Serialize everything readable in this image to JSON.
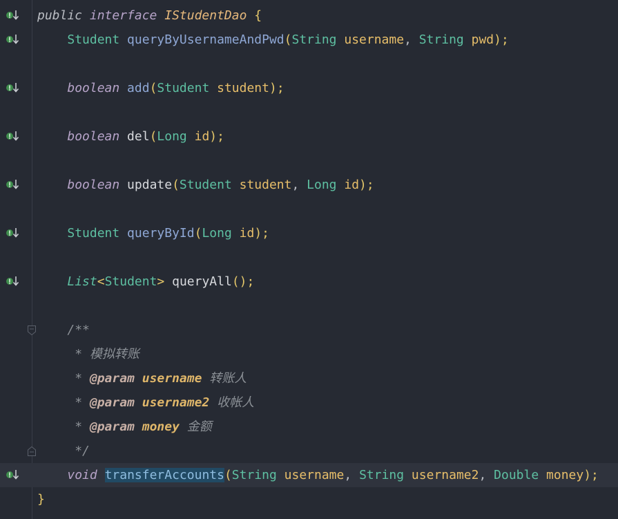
{
  "editor": {
    "lines": [
      {
        "parts": [
          {
            "t": "public ",
            "c": "mod"
          },
          {
            "t": "interface ",
            "c": "kw"
          },
          {
            "t": "IStudentDao",
            "c": "iname"
          },
          {
            "t": " {",
            "c": "br"
          }
        ],
        "gutter": true
      },
      {
        "parts": [
          {
            "t": "    "
          },
          {
            "t": "Student",
            "c": "typ"
          },
          {
            "t": " queryByUsernameAndPwd",
            "c": "decl"
          },
          {
            "t": "(",
            "c": "br"
          },
          {
            "t": "String",
            "c": "typ"
          },
          {
            "t": " username",
            "c": "param"
          },
          {
            "t": ", ",
            "c": "punc"
          },
          {
            "t": "String",
            "c": "typ"
          },
          {
            "t": " pwd",
            "c": "param"
          },
          {
            "t": ");",
            "c": "br"
          }
        ],
        "gutter": true
      },
      {
        "parts": []
      },
      {
        "parts": [
          {
            "t": "    "
          },
          {
            "t": "boolean",
            "c": "kw"
          },
          {
            "t": " add",
            "c": "decl"
          },
          {
            "t": "(",
            "c": "br"
          },
          {
            "t": "Student",
            "c": "typ"
          },
          {
            "t": " student",
            "c": "param"
          },
          {
            "t": ");",
            "c": "br"
          }
        ],
        "gutter": true
      },
      {
        "parts": []
      },
      {
        "parts": [
          {
            "t": "    "
          },
          {
            "t": "boolean",
            "c": "kw"
          },
          {
            "t": " del",
            "c": "call"
          },
          {
            "t": "(",
            "c": "br"
          },
          {
            "t": "Long",
            "c": "typ"
          },
          {
            "t": " id",
            "c": "param"
          },
          {
            "t": ");",
            "c": "br"
          }
        ],
        "gutter": true
      },
      {
        "parts": []
      },
      {
        "parts": [
          {
            "t": "    "
          },
          {
            "t": "boolean",
            "c": "kw"
          },
          {
            "t": " update",
            "c": "call"
          },
          {
            "t": "(",
            "c": "br"
          },
          {
            "t": "Student",
            "c": "typ"
          },
          {
            "t": " student",
            "c": "param"
          },
          {
            "t": ", ",
            "c": "punc"
          },
          {
            "t": "Long",
            "c": "typ"
          },
          {
            "t": " id",
            "c": "param"
          },
          {
            "t": ");",
            "c": "br"
          }
        ],
        "gutter": true
      },
      {
        "parts": []
      },
      {
        "parts": [
          {
            "t": "    "
          },
          {
            "t": "Student",
            "c": "typ"
          },
          {
            "t": " queryById",
            "c": "decl"
          },
          {
            "t": "(",
            "c": "br"
          },
          {
            "t": "Long",
            "c": "typ"
          },
          {
            "t": " id",
            "c": "param"
          },
          {
            "t": ");",
            "c": "br"
          }
        ],
        "gutter": true
      },
      {
        "parts": []
      },
      {
        "parts": [
          {
            "t": "    "
          },
          {
            "t": "List",
            "c": "ityp"
          },
          {
            "t": "<",
            "c": "br"
          },
          {
            "t": "Student",
            "c": "typ"
          },
          {
            "t": ">",
            "c": "br"
          },
          {
            "t": " queryAll",
            "c": "call"
          },
          {
            "t": "();",
            "c": "br"
          }
        ],
        "gutter": true
      },
      {
        "parts": []
      },
      {
        "parts": [
          {
            "t": "    "
          },
          {
            "t": "/**",
            "c": "cmt"
          }
        ],
        "fold": "open"
      },
      {
        "parts": [
          {
            "t": "     "
          },
          {
            "t": "* 模拟转账",
            "c": "cmt"
          }
        ]
      },
      {
        "parts": [
          {
            "t": "     "
          },
          {
            "t": "* ",
            "c": "cmt"
          },
          {
            "t": "@param",
            "c": "tag"
          },
          {
            "t": " username",
            "c": "tagv"
          },
          {
            "t": " 转账人",
            "c": "cmt"
          }
        ]
      },
      {
        "parts": [
          {
            "t": "     "
          },
          {
            "t": "* ",
            "c": "cmt"
          },
          {
            "t": "@param",
            "c": "tag"
          },
          {
            "t": " username2",
            "c": "tagv"
          },
          {
            "t": " 收帐人",
            "c": "cmt"
          }
        ]
      },
      {
        "parts": [
          {
            "t": "     "
          },
          {
            "t": "* ",
            "c": "cmt"
          },
          {
            "t": "@param",
            "c": "tag"
          },
          {
            "t": " money",
            "c": "tagv"
          },
          {
            "t": " 金额",
            "c": "cmt"
          }
        ]
      },
      {
        "parts": [
          {
            "t": "     "
          },
          {
            "t": "*/",
            "c": "cmt"
          }
        ],
        "fold": "close"
      },
      {
        "parts": [
          {
            "t": "    "
          },
          {
            "t": "void",
            "c": "kw"
          },
          {
            "t": " "
          },
          {
            "t": "transferAccounts",
            "c": "sel"
          },
          {
            "t": "(",
            "c": "br"
          },
          {
            "t": "String",
            "c": "typ"
          },
          {
            "t": " username",
            "c": "param"
          },
          {
            "t": ", ",
            "c": "punc"
          },
          {
            "t": "String",
            "c": "typ"
          },
          {
            "t": " username2",
            "c": "param"
          },
          {
            "t": ", ",
            "c": "punc"
          },
          {
            "t": "Double",
            "c": "typ"
          },
          {
            "t": " money",
            "c": "param"
          },
          {
            "t": ");",
            "c": "br"
          }
        ],
        "gutter": true,
        "current": true
      },
      {
        "parts": [
          {
            "t": "}",
            "c": "br"
          }
        ]
      }
    ]
  },
  "theme": {
    "background": "#262a33",
    "keyword": "#b7a4c9",
    "type": "#5ec0a2",
    "param": "#e8bf6a",
    "comment": "#8b9096",
    "selection": "#214a64"
  }
}
